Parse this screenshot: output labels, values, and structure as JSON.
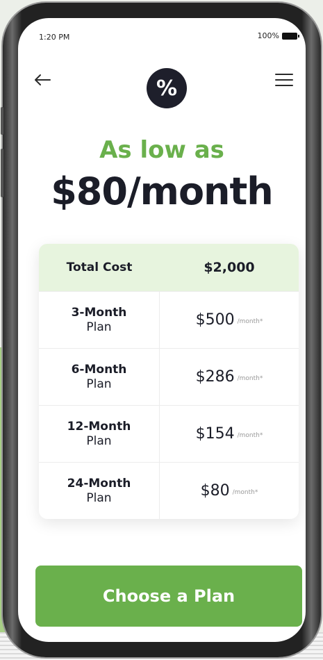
{
  "status_bar": {
    "time": "1:20 PM",
    "battery": "100%"
  },
  "header": {
    "logo_symbol": "%"
  },
  "hero": {
    "tagline": "As low as",
    "headline": "$80/month"
  },
  "pricing_table": {
    "header": {
      "label": "Total Cost",
      "value": "$2,000"
    },
    "rows": [
      {
        "plan_line1": "3-Month",
        "plan_line2": "Plan",
        "price": "$500",
        "unit": "/month*"
      },
      {
        "plan_line1": "6-Month",
        "plan_line2": "Plan",
        "price": "$286",
        "unit": "/month*"
      },
      {
        "plan_line1": "12-Month",
        "plan_line2": "Plan",
        "price": "$154",
        "unit": "/month*"
      },
      {
        "plan_line1": "24-Month",
        "plan_line2": "Plan",
        "price": "$80",
        "unit": "/month*"
      }
    ]
  },
  "cta": {
    "label": "Choose a Plan"
  },
  "colors": {
    "accent": "#6ab04c",
    "header_tint": "#e7f4de",
    "dark": "#1b1d28"
  }
}
